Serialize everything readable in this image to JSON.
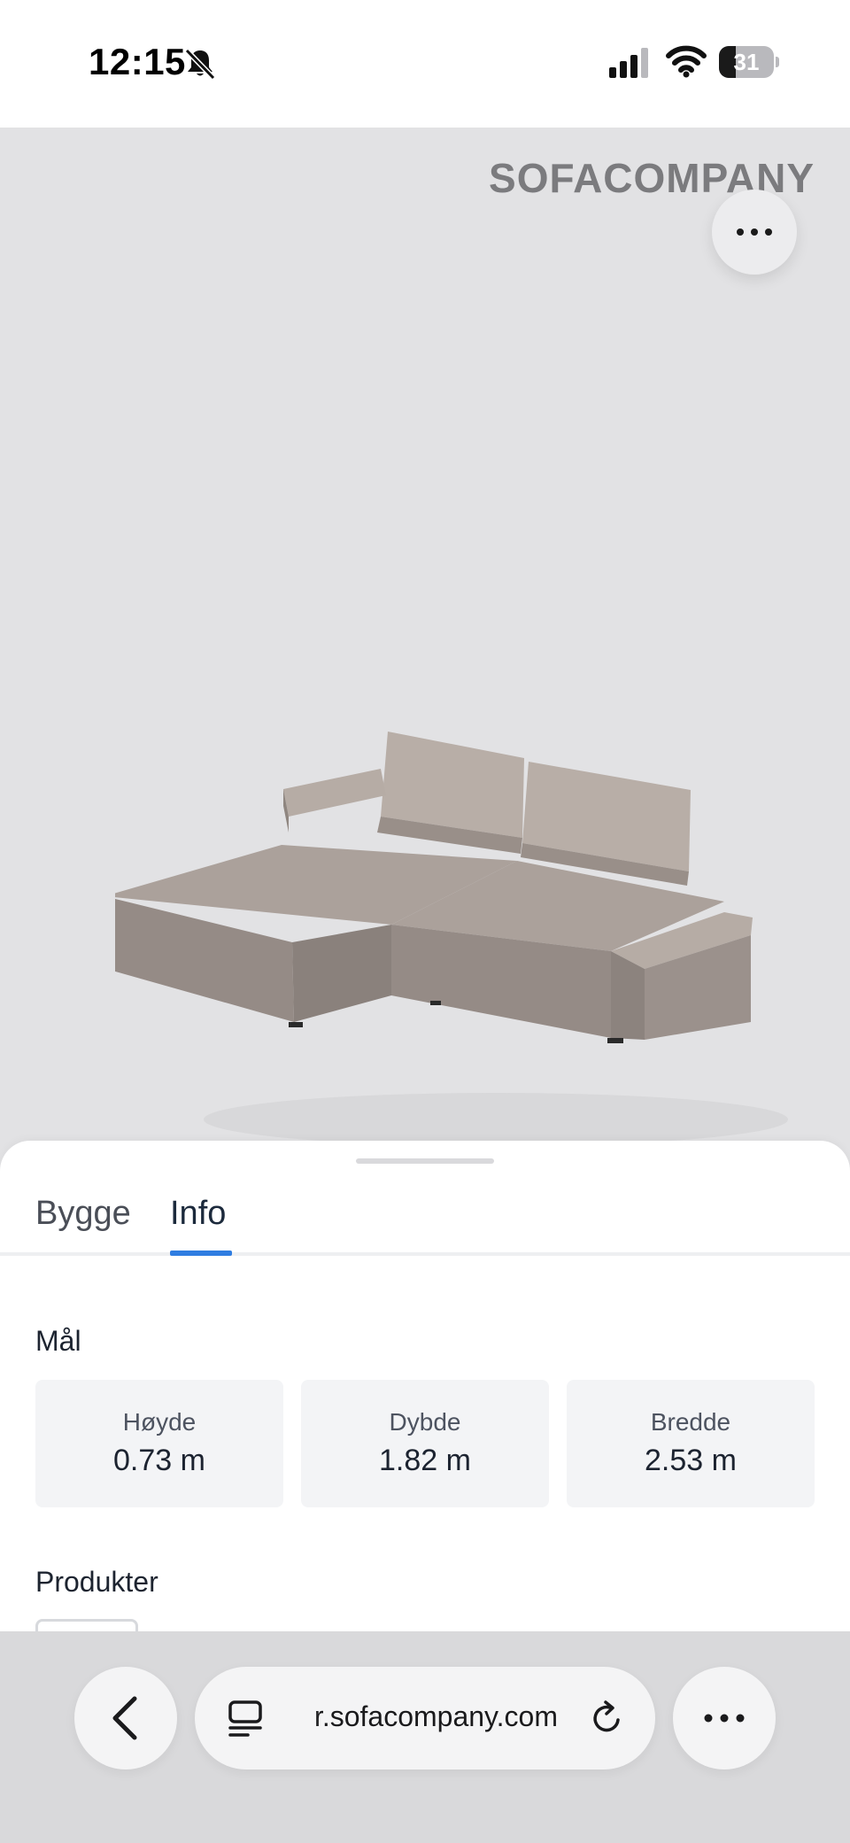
{
  "status_bar": {
    "time": "12:15",
    "battery_level": "31",
    "icons": [
      "bell-slash-icon",
      "cellular-signal-icon",
      "wifi-icon",
      "battery-icon"
    ]
  },
  "viewer": {
    "brand": "SOFACOMPANY",
    "more_icon": "ellipsis-icon",
    "image": "sofa-illustration"
  },
  "sheet": {
    "tabs": [
      {
        "label": "Bygge",
        "active": false
      },
      {
        "label": "Info",
        "active": true
      }
    ],
    "dimensions_title": "Mål",
    "dimensions": [
      {
        "label": "Høyde",
        "value": "0.73 m"
      },
      {
        "label": "Dybde",
        "value": "1.82 m"
      },
      {
        "label": "Bredde",
        "value": "2.53 m"
      }
    ],
    "products_title": "Produkter"
  },
  "browser": {
    "url": "r.sofacompany.com",
    "back_icon": "chevron-left-icon",
    "tabs_icon": "tabs-icon",
    "reload_icon": "reload-icon",
    "more_icon": "ellipsis-icon"
  },
  "colors": {
    "accent": "#2f7de1",
    "viewer_background": "#e2e2e4",
    "sofa_fabric": "#a89d97"
  }
}
